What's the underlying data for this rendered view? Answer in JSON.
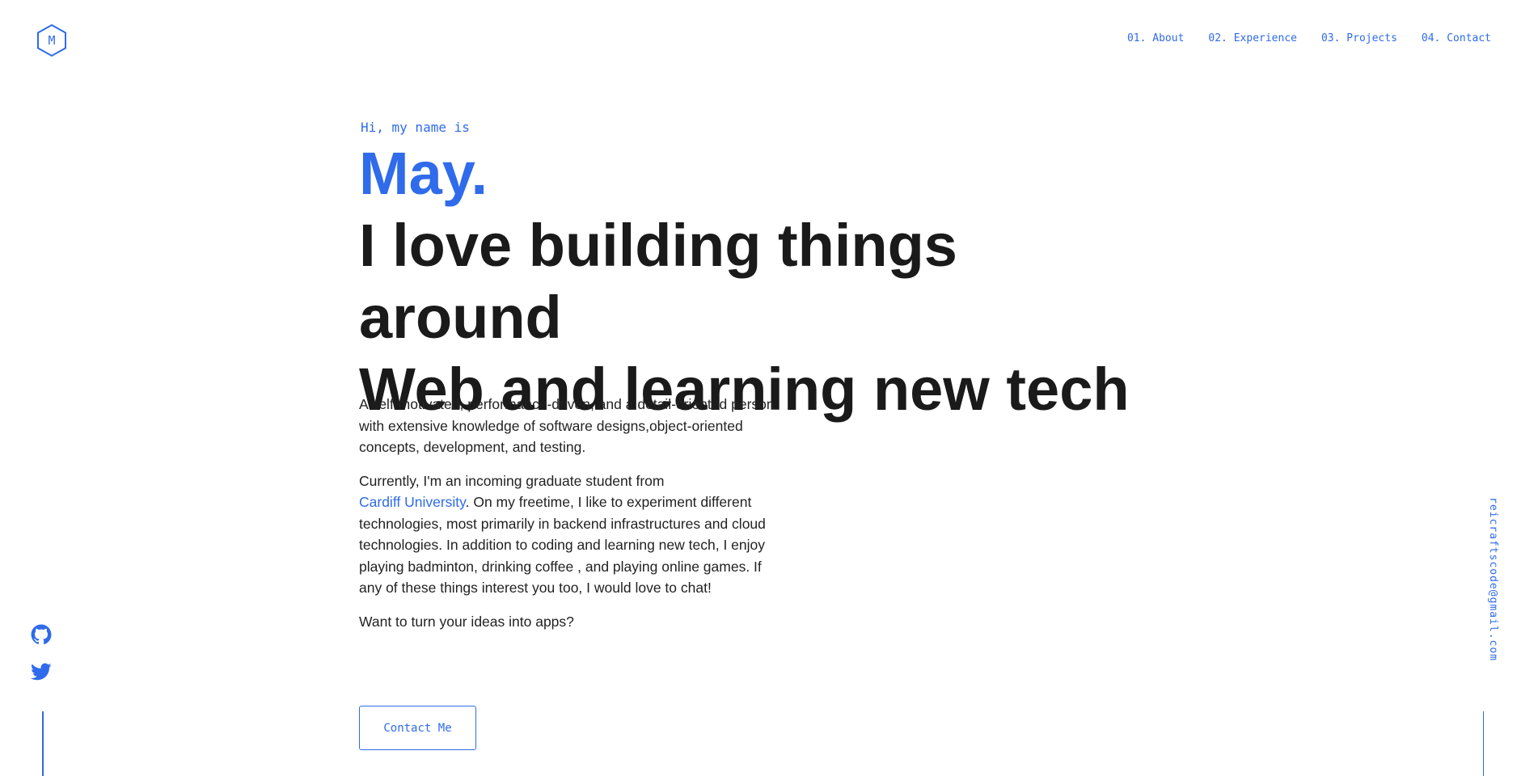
{
  "brand": {
    "logo_letter": "M",
    "accent_color": "#2f6bea",
    "icon": "hexagon-logo-icon"
  },
  "nav": {
    "items": [
      {
        "label": "01. About"
      },
      {
        "label": "02. Experience"
      },
      {
        "label": "03. Projects"
      },
      {
        "label": "04. Contact"
      }
    ]
  },
  "hero": {
    "greeting": "Hi, my name is",
    "name": "May.",
    "headline_line1": "I love building things around",
    "headline_line2": "Web and learning new tech"
  },
  "about": {
    "paragraph1": "A self-motivated, performance-driven, and a detail-oriented person with extensive knowledge of software designs,object-oriented concepts, development, and testing.",
    "paragraph2_prefix": "Currently, I'm an incoming graduate student from",
    "university_link": "Cardiff University",
    "paragraph2_suffix": ". On my freetime, I like to experiment different technologies, most primarily in backend infrastructures and cloud technologies. In addition to coding and learning new tech, I enjoy playing badminton, drinking coffee , and playing online games. If any of these things interest you too, I would love to chat!",
    "paragraph3": "Want to turn your ideas into apps?"
  },
  "cta": {
    "label": "Contact Me"
  },
  "social": {
    "items": [
      {
        "icon": "github-icon"
      },
      {
        "icon": "twitter-icon"
      }
    ]
  },
  "email": "reicraftscode@gmail.com"
}
